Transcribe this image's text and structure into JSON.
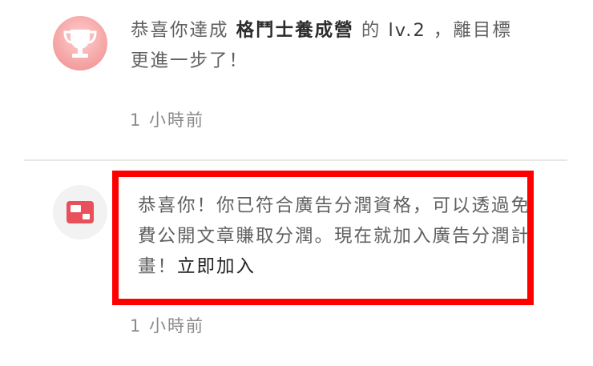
{
  "notifications": [
    {
      "icon": "trophy-icon",
      "text_prefix": "恭喜你達成 ",
      "achievement_name": "格鬥士養成營",
      "text_middle": " 的 ",
      "level": "lv.2",
      "text_suffix": " ，離目標更進一步了！",
      "time": "1 小時前"
    },
    {
      "icon": "ad-card-icon",
      "text": "恭喜你！你已符合廣告分潤資格，可以透過免費公開文章賺取分潤。現在就加入廣告分潤計畫！",
      "cta_label": "立即加入",
      "time": "1 小時前"
    }
  ],
  "colors": {
    "highlight_border": "#ff0000",
    "trophy_bg": "#f6a9a9",
    "ad_icon": "#e8505b"
  }
}
